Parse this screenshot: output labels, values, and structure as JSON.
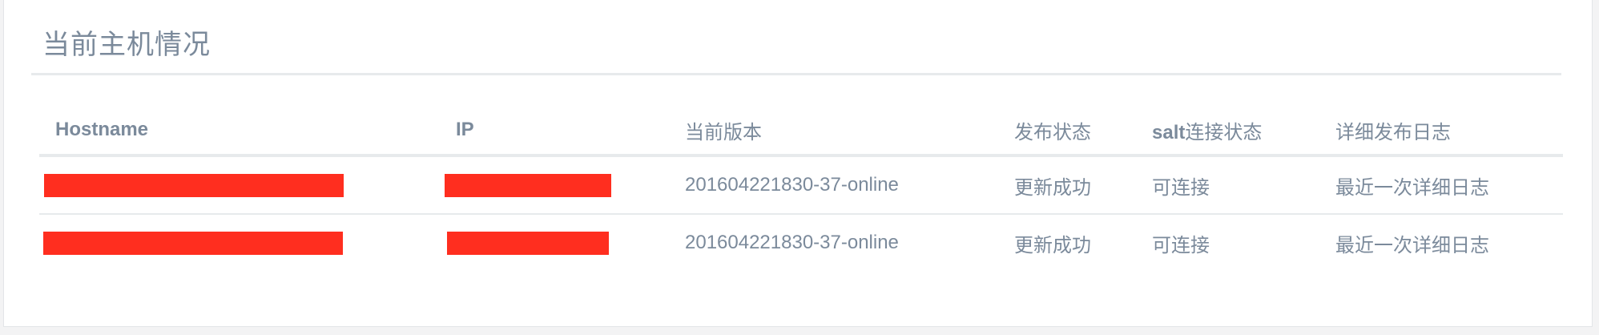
{
  "panel": {
    "title": "当前主机情况"
  },
  "table": {
    "headers": {
      "hostname": "Hostname",
      "ip": "IP",
      "version": "当前版本",
      "publish_status": "发布状态",
      "salt_prefix": "salt",
      "salt_suffix": "连接状态",
      "log": "详细发布日志"
    },
    "rows": [
      {
        "hostname": "[redacted]",
        "ip": "[redacted]",
        "version": "201604221830-37-online",
        "publish_status": "更新成功",
        "salt_status": "可连接",
        "log_link": "最近一次详细日志"
      },
      {
        "hostname": "[redacted]",
        "ip": "[redacted]",
        "version": "201604221830-37-online",
        "publish_status": "更新成功",
        "salt_status": "可连接",
        "log_link": "最近一次详细日志"
      }
    ]
  },
  "colors": {
    "text": "#7b8a9b",
    "redaction": "#ff2e1f",
    "divider": "#e7eaec"
  }
}
